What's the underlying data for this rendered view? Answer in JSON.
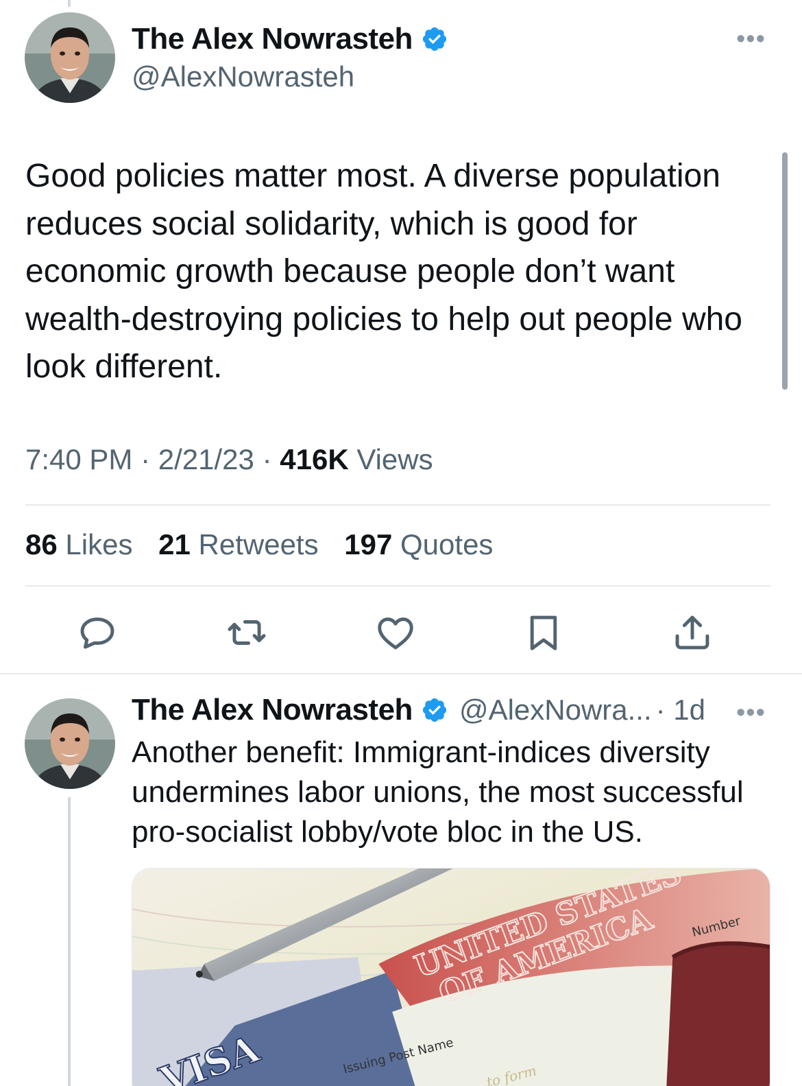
{
  "main_tweet": {
    "author": {
      "display_name": "The Alex Nowrasteh",
      "handle": "@AlexNowrasteh",
      "verified": true,
      "avatar_icon": "avatar-photo"
    },
    "more_icon": "•••",
    "text": "Good policies matter most. A diverse population reduces social solidarity, which is good for economic growth because people don’t want wealth-destroying policies to help out people who look different.",
    "meta": {
      "time": "7:40 PM",
      "sep": "·",
      "date": "2/21/23",
      "views_count": "416K",
      "views_label": "Views"
    },
    "stats": [
      {
        "count": "86",
        "label": "Likes"
      },
      {
        "count": "21",
        "label": "Retweets"
      },
      {
        "count": "197",
        "label": "Quotes"
      }
    ],
    "actions": [
      "reply-icon",
      "retweet-icon",
      "like-icon",
      "bookmark-icon",
      "share-icon"
    ]
  },
  "reply_tweet": {
    "author": {
      "display_name": "The Alex Nowrasteh",
      "handle": "@AlexNowra...",
      "verified": true
    },
    "time": "· 1d",
    "more_icon": "•••",
    "text": "Another benefit: Immigrant-indices diversity undermines labor unions, the most successful pro-socialist lobby/vote bloc in the US.",
    "media": {
      "visa_text": "VISA",
      "usa_text_1": "UNITED STATES",
      "usa_text_2": "OF AMERICA",
      "issuing_post_text": "Issuing Post Name",
      "number_text": "Number",
      "form_text": "to form"
    }
  },
  "colors": {
    "text": "#0f1419",
    "secondary": "#536471",
    "verified_blue": "#1d9bf0",
    "divider": "#e7e9ea"
  }
}
